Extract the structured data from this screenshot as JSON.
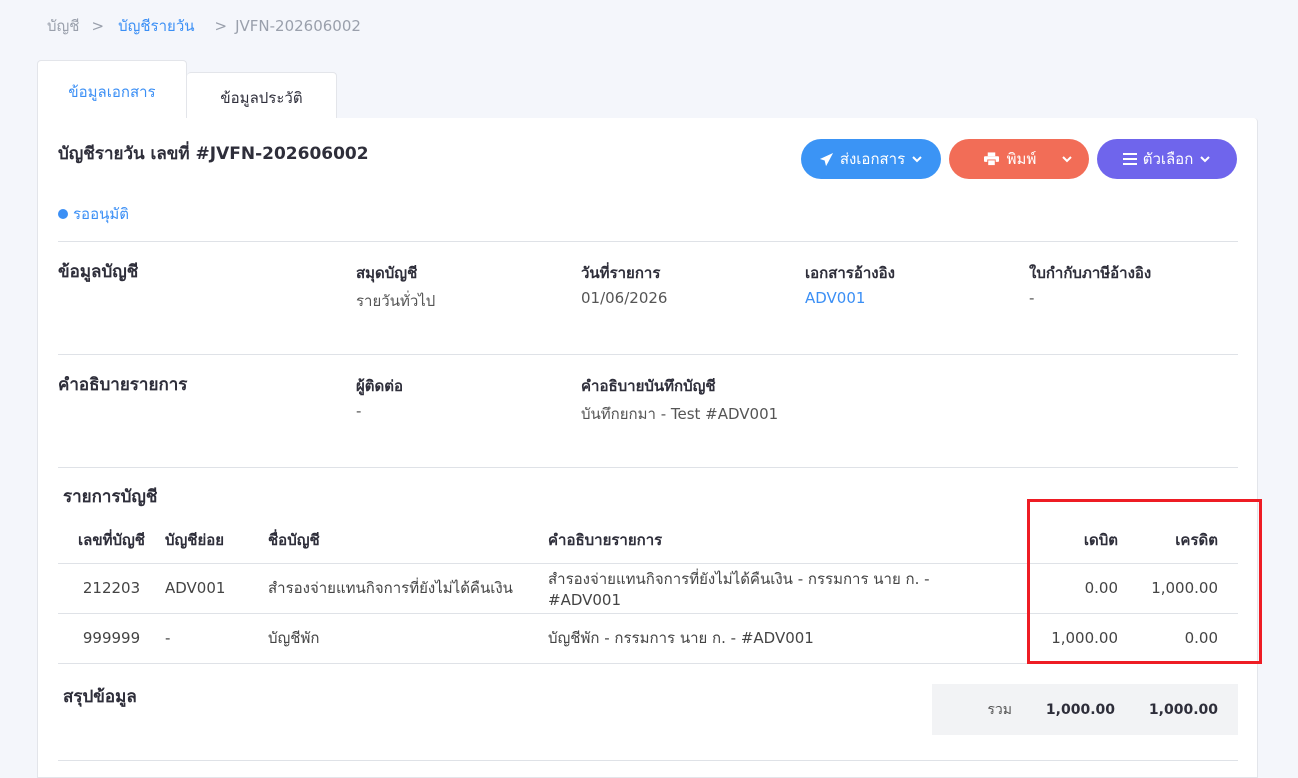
{
  "breadcrumb": {
    "root": "บัญชี",
    "parent": "บัญชีรายวัน",
    "current": "JVFN-202606002",
    "sep": ">"
  },
  "tabs": [
    {
      "label": "ข้อมูลเอกสาร",
      "active": true
    },
    {
      "label": "ข้อมูลประวัติ",
      "active": false
    }
  ],
  "header": {
    "title": "บัญชีรายวัน เลขที่ #JVFN-202606002",
    "status": "รออนุมัติ"
  },
  "buttons": {
    "send": "ส่งเอกสาร",
    "print": "พิมพ์",
    "options": "ตัวเลือก"
  },
  "account_info": {
    "section_title": "ข้อมูลบัญชี",
    "book_label": "สมุดบัญชี",
    "book_value": "รายวันทั่วไป",
    "date_label": "วันที่รายการ",
    "date_value": "01/06/2026",
    "ref_doc_label": "เอกสารอ้างอิง",
    "ref_doc_value": "ADV001",
    "tax_invoice_label": "ใบกำกับภาษีอ้างอิง",
    "tax_invoice_value": "-"
  },
  "description": {
    "section_title": "คำอธิบายรายการ",
    "contact_label": "ผู้ติดต่อ",
    "contact_value": "-",
    "memo_label": "คำอธิบายบันทึกบัญชี",
    "memo_value": "บันทึกยกมา - Test #ADV001"
  },
  "entries": {
    "section_title": "รายการบัญชี",
    "columns": {
      "account_no": "เลขที่บัญชี",
      "sub_account": "บัญชีย่อย",
      "account_name": "ชื่อบัญชี",
      "description": "คำอธิบายรายการ",
      "debit": "เดบิต",
      "credit": "เครดิต"
    },
    "rows": [
      {
        "account_no": "212203",
        "sub_account": "ADV001",
        "account_name": "สำรองจ่ายแทนกิจการที่ยังไม่ได้คืนเงิน",
        "description": "สำรองจ่ายแทนกิจการที่ยังไม่ได้คืนเงิน - กรรมการ นาย ก. - #ADV001",
        "debit": "0.00",
        "credit": "1,000.00"
      },
      {
        "account_no": "999999",
        "sub_account": "-",
        "account_name": "บัญชีพัก",
        "description": "บัญชีพัก - กรรมการ นาย ก. - #ADV001",
        "debit": "1,000.00",
        "credit": "0.00"
      }
    ]
  },
  "summary": {
    "section_title": "สรุปข้อมูล",
    "total_label": "รวม",
    "total_debit": "1,000.00",
    "total_credit": "1,000.00"
  },
  "colors": {
    "accent": "#3b8ff5",
    "send_button": "#3b94f5",
    "print_button": "#f26d57",
    "options_button": "#6f65ec",
    "highlight": "#ee1c24"
  }
}
